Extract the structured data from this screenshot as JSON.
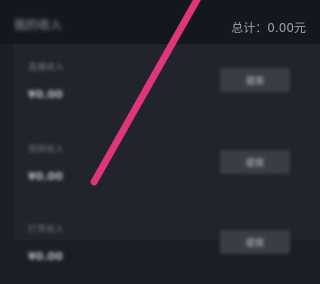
{
  "header": {
    "title": "我的收入",
    "total": "总计：0.00元"
  },
  "rows": [
    {
      "label": "直播收入",
      "amount": "¥0.00",
      "button": "提现"
    },
    {
      "label": "视频收入",
      "amount": "¥0.00",
      "button": "提现"
    },
    {
      "label": "打赏收入",
      "amount": "¥0.00",
      "button": "提现"
    }
  ],
  "colors": {
    "background": "#1c1e27",
    "header": "#15171e",
    "annotation_stroke": "#e0357a"
  }
}
